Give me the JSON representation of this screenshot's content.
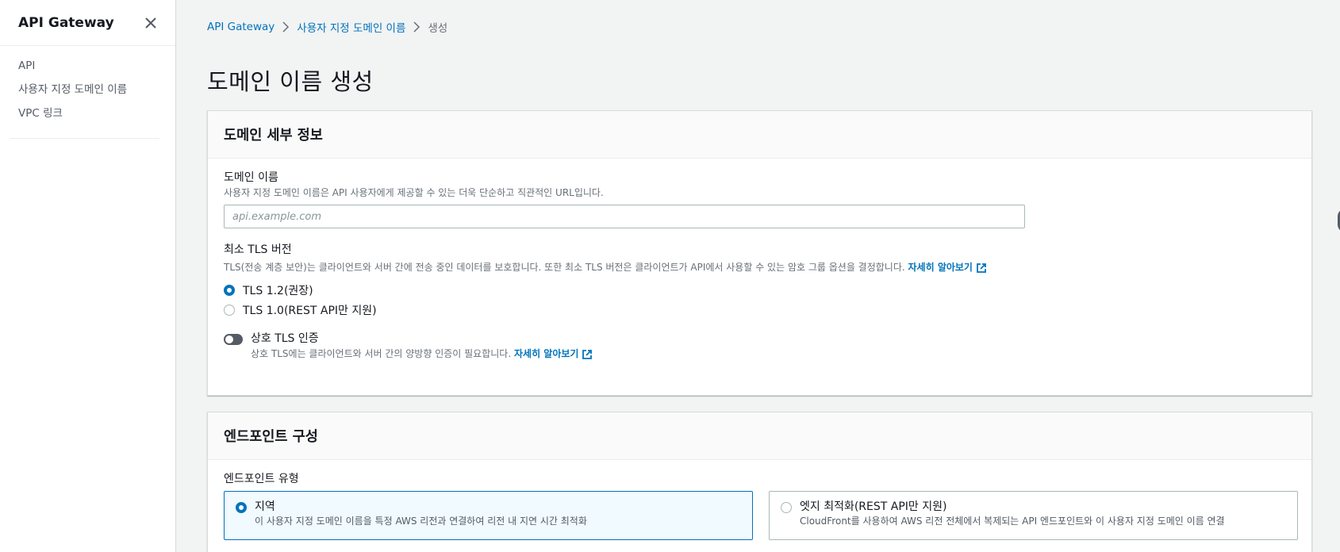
{
  "sidebar": {
    "title": "API Gateway",
    "items": [
      {
        "label": "API"
      },
      {
        "label": "사용자 지정 도메인 이름"
      },
      {
        "label": "VPC 링크"
      }
    ]
  },
  "breadcrumb": {
    "items": [
      "API Gateway",
      "사용자 지정 도메인 이름"
    ],
    "current": "생성"
  },
  "page": {
    "title": "도메인 이름 생성"
  },
  "domain_details": {
    "title": "도메인 세부 정보",
    "domain_name": {
      "label": "도메인 이름",
      "description": "사용자 지정 도메인 이름은 API 사용자에게 제공할 수 있는 더욱 단순하고 직관적인 URL입니다.",
      "placeholder": "api.example.com"
    },
    "tls": {
      "label": "최소 TLS 버전",
      "description": "TLS(전송 계층 보안)는 클라이언트와 서버 간에 전송 중인 데이터를 보호합니다. 또한 최소 TLS 버전은 클라이언트가 API에서 사용할 수 있는 암호 그룹 옵션을 결정합니다.",
      "learn_more": "자세히 알아보기",
      "options": [
        {
          "label": "TLS 1.2(권장)",
          "selected": true
        },
        {
          "label": "TLS 1.0(REST API만 지원)",
          "selected": false
        }
      ]
    },
    "mutual_tls": {
      "label": "상호 TLS 인증",
      "description": "상호 TLS에는 클라이언트와 서버 간의 양방향 인증이 필요합니다.",
      "learn_more": "자세히 알아보기",
      "enabled": false
    }
  },
  "endpoint_config": {
    "title": "엔드포인트 구성",
    "type_label": "엔드포인트 유형",
    "options": [
      {
        "title": "지역",
        "description": "이 사용자 지정 도메인 이름을 특정 AWS 리전과 연결하여 리전 내 지연 시간 최적화",
        "selected": true
      },
      {
        "title": "엣지 최적화(REST API만 지원)",
        "description": "CloudFront를 사용하여 AWS 리전 전체에서 복제되는 API 엔드포인트와 이 사용자 지정 도메인 이름 연결",
        "selected": false
      }
    ]
  },
  "colors": {
    "link": "#0073bb",
    "selected_tile_bg": "#f1faff",
    "toggle_off": "#545b64"
  },
  "icons": {
    "close": "close-icon",
    "breadcrumb_separator": "chevron-right-icon",
    "external_link": "external-link-icon"
  }
}
